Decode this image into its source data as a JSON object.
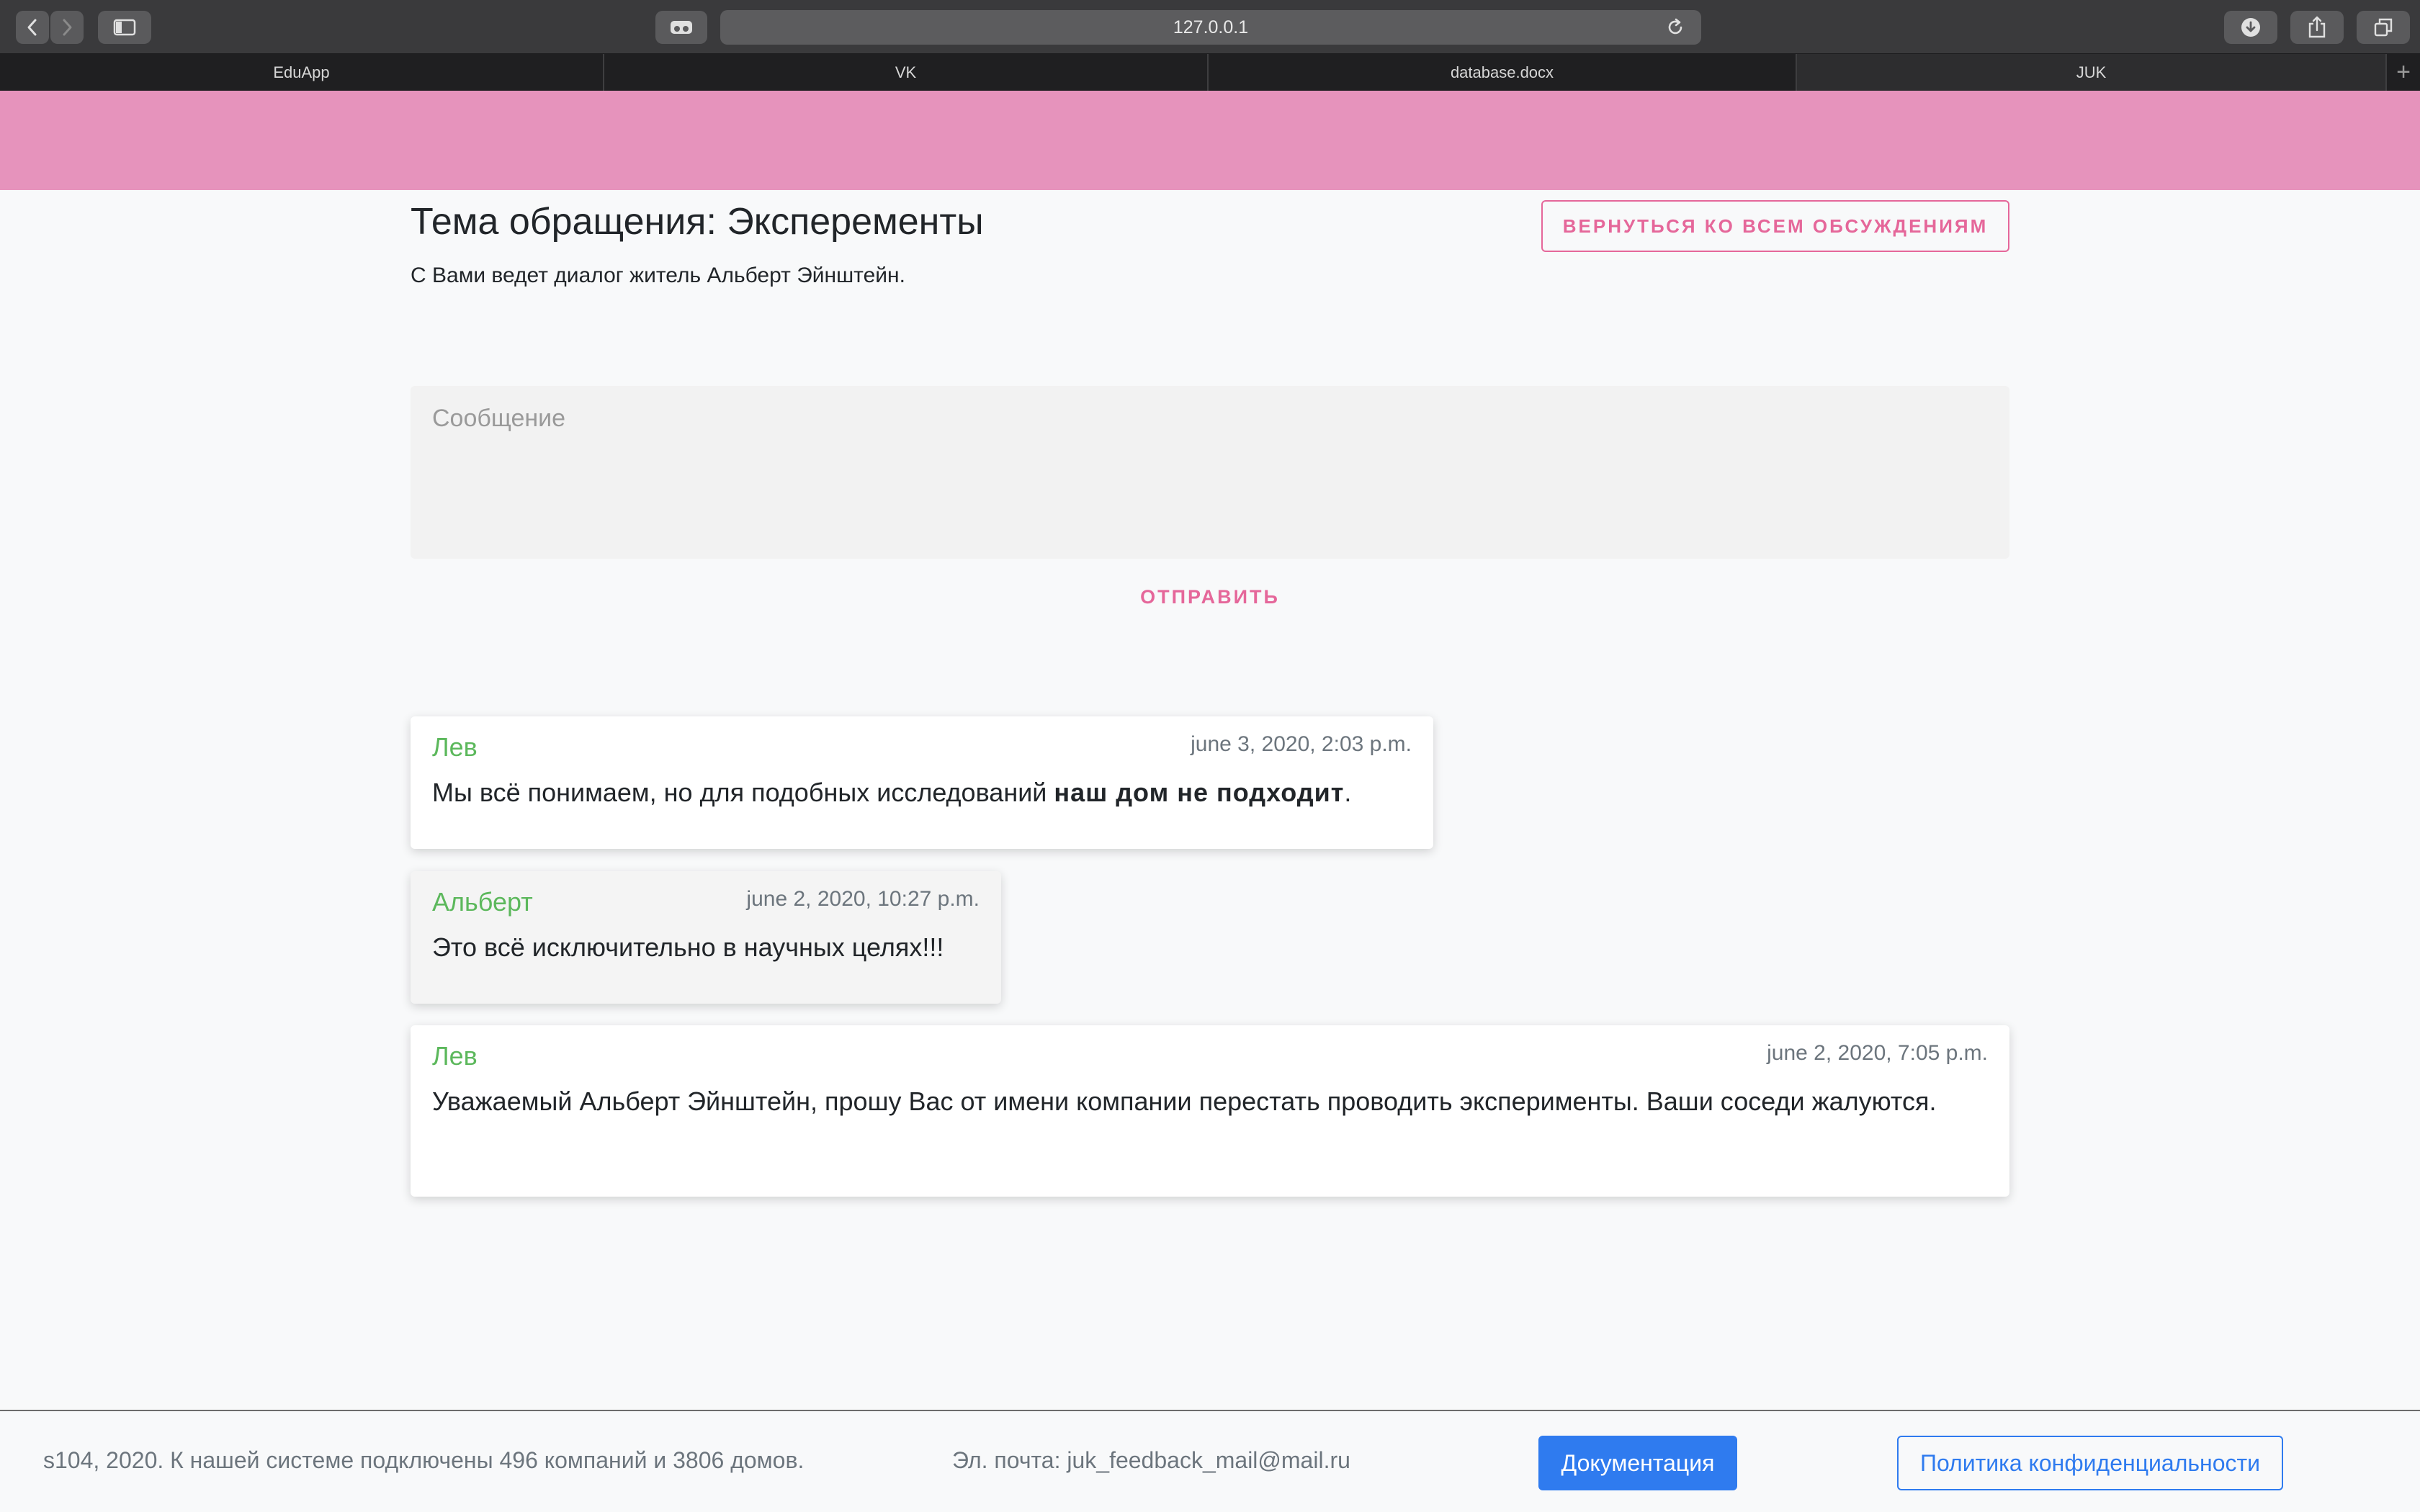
{
  "browser": {
    "url": "127.0.0.1",
    "tabs": [
      {
        "label": "EduApp",
        "active": false
      },
      {
        "label": "VK",
        "active": false
      },
      {
        "label": "database.docx",
        "active": false
      },
      {
        "label": "JUK",
        "active": true
      }
    ],
    "icons": {
      "back": "chevron-left-icon",
      "forward": "chevron-right-icon",
      "sidebar": "sidebar-icon",
      "reader": "reader-icon",
      "reload": "reload-icon",
      "download": "download-icon",
      "share": "share-icon",
      "tabs_overview": "tabs-overview-icon",
      "new_tab": "plus-icon"
    }
  },
  "header": {
    "accent_color": "#e693bc"
  },
  "topic": {
    "title": "Тема обращения: Эксперементы",
    "subtitle": "С Вами ведет диалог житель Альберт Эйнштейн.",
    "back_label": "ВЕРНУТЬСЯ КО ВСЕМ ОБСУЖДЕНИЯМ"
  },
  "composer": {
    "placeholder": "Сообщение",
    "value": "",
    "send_label": "ОТПРАВИТЬ"
  },
  "messages": [
    {
      "author": "Лев",
      "date": "june 3, 2020, 2:03 p.m.",
      "text_before": "Мы всё понимаем, но для подобных исследований ",
      "text_bold": "наш дом не подходит",
      "text_after": "."
    },
    {
      "author": "Альберт",
      "date": "june 2, 2020, 10:27 p.m.",
      "text": "Это всё исключительно в научных целях!!!"
    },
    {
      "author": "Лев",
      "date": "june 2, 2020, 7:05 p.m.",
      "text": "Уважаемый Альберт Эйнштейн, прошу Вас от имени компании перестать проводить эксперименты. Ваши соседи жалуются."
    }
  ],
  "footer": {
    "info": "s104, 2020. К нашей системе подключены 496 компаний и 3806 домов.",
    "email": "Эл. почта: juk_feedback_mail@mail.ru",
    "docs_label": "Документация",
    "privacy_label": "Политика конфиденциальности"
  },
  "colors": {
    "accent_pink": "#e5679a",
    "author_green": "#5cb85c",
    "primary_blue": "#2f7bef"
  }
}
